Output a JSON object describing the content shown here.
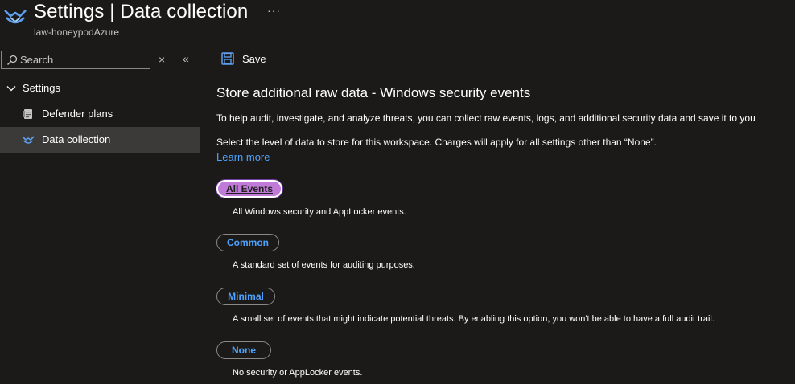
{
  "header": {
    "title": "Settings | Data collection",
    "subtitle": "law-honeypodAzure",
    "more_label": "···",
    "app_icon": "security-center-icon"
  },
  "sidebar": {
    "search_placeholder": "Search",
    "search_value": "",
    "clear_label": "×",
    "collapse_label": "«",
    "group": {
      "label": "Settings",
      "icon": "chevron-down-icon"
    },
    "items": [
      {
        "label": "Defender plans",
        "icon": "defender-plans-icon",
        "active": false
      },
      {
        "label": "Data collection",
        "icon": "data-collection-icon",
        "active": true
      }
    ]
  },
  "toolbar": {
    "save_label": "Save",
    "save_icon": "save-icon"
  },
  "content": {
    "title": "Store additional raw data - Windows security events",
    "intro": "To help audit, investigate, and analyze threats, you can collect raw events, logs, and additional security data and save it to you",
    "select_text": "Select the level of data to store for this workspace. Charges will apply for all settings other than “None”.",
    "learn_more": "Learn more",
    "options": [
      {
        "label": "All Events",
        "description": "All Windows security and AppLocker events.",
        "selected": true
      },
      {
        "label": "Common",
        "description": "A standard set of events for auditing purposes.",
        "selected": false
      },
      {
        "label": "Minimal",
        "description": "A small set of events that might indicate potential threats. By enabling this option, you won't be able to have a full audit trail.",
        "selected": false
      },
      {
        "label": "None",
        "description": "No security or AppLocker events.",
        "selected": false
      }
    ]
  },
  "colors": {
    "background": "#1b1a19",
    "link": "#4da3ff",
    "active_nav": "#3b3a39",
    "selected_pill": "#c07bd8"
  }
}
